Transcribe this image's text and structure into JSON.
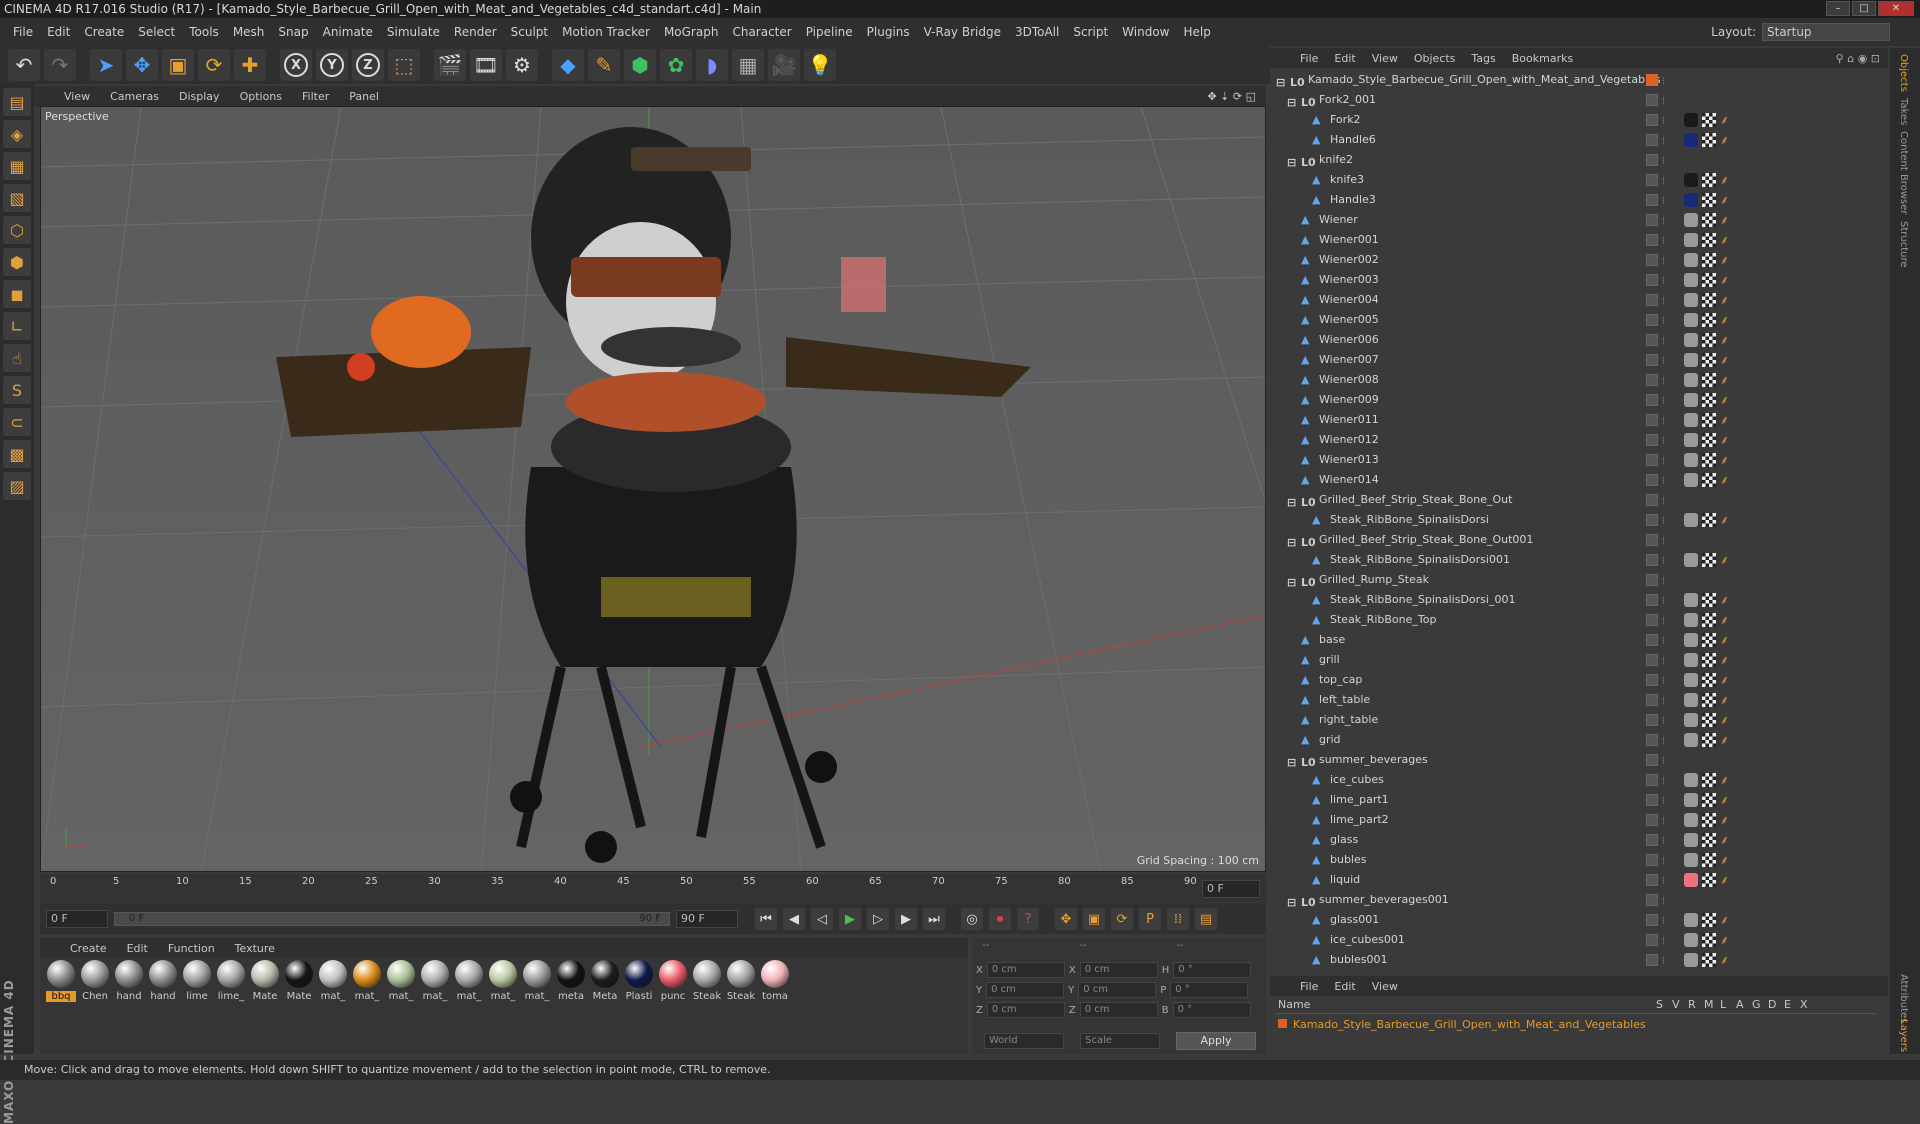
{
  "window": {
    "title": "CINEMA 4D R17.016 Studio (R17) - [Kamado_Style_Barbecue_Grill_Open_with_Meat_and_Vegetables_c4d_standart.c4d] - Main"
  },
  "menubar": {
    "items": [
      "File",
      "Edit",
      "Create",
      "Select",
      "Tools",
      "Mesh",
      "Snap",
      "Animate",
      "Simulate",
      "Render",
      "Sculpt",
      "Motion Tracker",
      "MoGraph",
      "Character",
      "Pipeline",
      "Plugins",
      "V-Ray Bridge",
      "3DToAll",
      "Script",
      "Window",
      "Help"
    ],
    "layout_label": "Layout:",
    "layout_value": "Startup"
  },
  "viewport": {
    "menu": [
      "View",
      "Cameras",
      "Display",
      "Options",
      "Filter",
      "Panel"
    ],
    "label": "Perspective",
    "grid_spacing": "Grid Spacing : 100 cm"
  },
  "timeline": {
    "ticks": [
      "0",
      "5",
      "10",
      "15",
      "20",
      "25",
      "30",
      "35",
      "40",
      "45",
      "50",
      "55",
      "60",
      "65",
      "70",
      "75",
      "80",
      "85",
      "90"
    ],
    "current_frame": "0 F",
    "start_field": "0 F",
    "range_start": "0 F",
    "range_end": "90 F",
    "end_field": "90 F"
  },
  "material_manager": {
    "menu": [
      "Create",
      "Edit",
      "Function",
      "Texture"
    ],
    "materials": [
      {
        "name": "bbq",
        "color": "#8a8a8a"
      },
      {
        "name": "Chen",
        "color": "#9a9a9a"
      },
      {
        "name": "hand",
        "color": "#8e8e8e"
      },
      {
        "name": "hand",
        "color": "#8e8e8e"
      },
      {
        "name": "lime",
        "color": "#a0a0a0"
      },
      {
        "name": "lime_",
        "color": "#a4a4a4"
      },
      {
        "name": "Mate",
        "color": "#b8b8a8"
      },
      {
        "name": "Mate",
        "color": "#151515"
      },
      {
        "name": "mat_",
        "color": "#c0c0c0"
      },
      {
        "name": "mat_",
        "color": "#d98a1a"
      },
      {
        "name": "mat_",
        "color": "#a8c098"
      },
      {
        "name": "mat_",
        "color": "#b0b0b0"
      },
      {
        "name": "mat_",
        "color": "#a8a8a8"
      },
      {
        "name": "mat_",
        "color": "#b8c8a0"
      },
      {
        "name": "mat_",
        "color": "#9a9a9a"
      },
      {
        "name": "meta",
        "color": "#111111"
      },
      {
        "name": "Meta",
        "color": "#1c1c1c"
      },
      {
        "name": "Plasti",
        "color": "#0d1a4a"
      },
      {
        "name": "punc",
        "color": "#e85c6a"
      },
      {
        "name": "Steak",
        "color": "#a8a8a8"
      },
      {
        "name": "Steak",
        "color": "#a4a4a4"
      },
      {
        "name": "toma",
        "color": "#f0b0b8"
      }
    ]
  },
  "coordinates": {
    "header": [
      "--",
      "--",
      "--"
    ],
    "rows": [
      {
        "a": "X",
        "av": "0 cm",
        "b": "X",
        "bv": "0 cm",
        "c": "H",
        "cv": "0 °"
      },
      {
        "a": "Y",
        "av": "0 cm",
        "b": "Y",
        "bv": "0 cm",
        "c": "P",
        "cv": "0 °"
      },
      {
        "a": "Z",
        "av": "0 cm",
        "b": "Z",
        "bv": "0 cm",
        "c": "B",
        "cv": "0 °"
      }
    ],
    "world": "World",
    "scale": "Scale",
    "apply": "Apply"
  },
  "object_manager": {
    "menu": [
      "File",
      "Edit",
      "View",
      "Objects",
      "Tags",
      "Bookmarks"
    ],
    "objects": [
      {
        "name": "Kamado_Style_Barbecue_Grill_Open_with_Meat_and_Vegetables",
        "depth": 0,
        "type": "null",
        "tags": []
      },
      {
        "name": "Fork2_001",
        "depth": 1,
        "type": "null",
        "tags": []
      },
      {
        "name": "Fork2",
        "depth": 2,
        "type": "obj",
        "tags": [
          "dark",
          "tex",
          "phong"
        ]
      },
      {
        "name": "Handle6",
        "depth": 2,
        "type": "obj",
        "tags": [
          "blue",
          "tex",
          "phong"
        ]
      },
      {
        "name": "knife2",
        "depth": 1,
        "type": "null",
        "tags": []
      },
      {
        "name": "knife3",
        "depth": 2,
        "type": "obj",
        "tags": [
          "dark",
          "tex",
          "phong"
        ]
      },
      {
        "name": "Handle3",
        "depth": 2,
        "type": "obj",
        "tags": [
          "blue",
          "tex",
          "phong"
        ]
      },
      {
        "name": "Wiener",
        "depth": 1,
        "type": "obj",
        "tags": [
          "mat",
          "tex",
          "phong"
        ]
      },
      {
        "name": "Wiener001",
        "depth": 1,
        "type": "obj",
        "tags": [
          "mat",
          "tex",
          "phong"
        ]
      },
      {
        "name": "Wiener002",
        "depth": 1,
        "type": "obj",
        "tags": [
          "mat",
          "tex",
          "phong"
        ]
      },
      {
        "name": "Wiener003",
        "depth": 1,
        "type": "obj",
        "tags": [
          "mat",
          "tex",
          "phong"
        ]
      },
      {
        "name": "Wiener004",
        "depth": 1,
        "type": "obj",
        "tags": [
          "mat",
          "tex",
          "phong"
        ]
      },
      {
        "name": "Wiener005",
        "depth": 1,
        "type": "obj",
        "tags": [
          "mat",
          "tex",
          "phong"
        ]
      },
      {
        "name": "Wiener006",
        "depth": 1,
        "type": "obj",
        "tags": [
          "mat",
          "tex",
          "phong"
        ]
      },
      {
        "name": "Wiener007",
        "depth": 1,
        "type": "obj",
        "tags": [
          "mat",
          "tex",
          "phong"
        ]
      },
      {
        "name": "Wiener008",
        "depth": 1,
        "type": "obj",
        "tags": [
          "mat",
          "tex",
          "phong"
        ]
      },
      {
        "name": "Wiener009",
        "depth": 1,
        "type": "obj",
        "tags": [
          "mat",
          "tex",
          "phong"
        ]
      },
      {
        "name": "Wiener011",
        "depth": 1,
        "type": "obj",
        "tags": [
          "mat",
          "tex",
          "phong"
        ]
      },
      {
        "name": "Wiener012",
        "depth": 1,
        "type": "obj",
        "tags": [
          "mat",
          "tex",
          "phong"
        ]
      },
      {
        "name": "Wiener013",
        "depth": 1,
        "type": "obj",
        "tags": [
          "mat",
          "tex",
          "phong"
        ]
      },
      {
        "name": "Wiener014",
        "depth": 1,
        "type": "obj",
        "tags": [
          "mat",
          "tex",
          "phong"
        ]
      },
      {
        "name": "Grilled_Beef_Strip_Steak_Bone_Out",
        "depth": 1,
        "type": "null",
        "tags": []
      },
      {
        "name": "Steak_RibBone_SpinalisDorsi",
        "depth": 2,
        "type": "obj",
        "tags": [
          "mat",
          "tex",
          "phong"
        ]
      },
      {
        "name": "Grilled_Beef_Strip_Steak_Bone_Out001",
        "depth": 1,
        "type": "null",
        "tags": []
      },
      {
        "name": "Steak_RibBone_SpinalisDorsi001",
        "depth": 2,
        "type": "obj",
        "tags": [
          "mat",
          "tex",
          "phong"
        ]
      },
      {
        "name": "Grilled_Rump_Steak",
        "depth": 1,
        "type": "null",
        "tags": []
      },
      {
        "name": "Steak_RibBone_SpinalisDorsi_001",
        "depth": 2,
        "type": "obj",
        "tags": [
          "mat",
          "tex",
          "phong"
        ]
      },
      {
        "name": "Steak_RibBone_Top",
        "depth": 2,
        "type": "obj",
        "tags": [
          "mat",
          "tex",
          "phong"
        ]
      },
      {
        "name": "base",
        "depth": 1,
        "type": "obj",
        "tags": [
          "mat",
          "tex",
          "phong"
        ]
      },
      {
        "name": "grill",
        "depth": 1,
        "type": "obj",
        "tags": [
          "mat",
          "tex",
          "phong"
        ]
      },
      {
        "name": "top_cap",
        "depth": 1,
        "type": "obj",
        "tags": [
          "mat",
          "tex",
          "phong"
        ]
      },
      {
        "name": "left_table",
        "depth": 1,
        "type": "obj",
        "tags": [
          "mat",
          "tex",
          "phong"
        ]
      },
      {
        "name": "right_table",
        "depth": 1,
        "type": "obj",
        "tags": [
          "mat",
          "tex",
          "phong"
        ]
      },
      {
        "name": "grid",
        "depth": 1,
        "type": "obj",
        "tags": [
          "mat",
          "tex",
          "phong"
        ]
      },
      {
        "name": "summer_beverages",
        "depth": 1,
        "type": "null",
        "tags": []
      },
      {
        "name": "ice_cubes",
        "depth": 2,
        "type": "obj",
        "tags": [
          "mat",
          "tex",
          "phong"
        ]
      },
      {
        "name": "lime_part1",
        "depth": 2,
        "type": "obj",
        "tags": [
          "mat",
          "tex",
          "phong"
        ]
      },
      {
        "name": "lime_part2",
        "depth": 2,
        "type": "obj",
        "tags": [
          "mat",
          "tex",
          "phong"
        ]
      },
      {
        "name": "glass",
        "depth": 2,
        "type": "obj",
        "tags": [
          "mat",
          "tex",
          "phong"
        ]
      },
      {
        "name": "bubles",
        "depth": 2,
        "type": "obj",
        "tags": [
          "mat",
          "tex",
          "phong"
        ]
      },
      {
        "name": "liquid",
        "depth": 2,
        "type": "obj",
        "tags": [
          "pink",
          "tex",
          "phong"
        ]
      },
      {
        "name": "summer_beverages001",
        "depth": 1,
        "type": "null",
        "tags": []
      },
      {
        "name": "glass001",
        "depth": 2,
        "type": "obj",
        "tags": [
          "mat",
          "tex",
          "phong"
        ]
      },
      {
        "name": "ice_cubes001",
        "depth": 2,
        "type": "obj",
        "tags": [
          "mat",
          "tex",
          "phong"
        ]
      },
      {
        "name": "bubles001",
        "depth": 2,
        "type": "obj",
        "tags": [
          "mat",
          "tex",
          "phong"
        ]
      }
    ]
  },
  "attribute_manager": {
    "menu": [
      "File",
      "Edit",
      "View"
    ],
    "columns": [
      "Name",
      "S",
      "V",
      "R",
      "M",
      "L",
      "A",
      "G",
      "D",
      "E",
      "X"
    ],
    "selected_object": "Kamado_Style_Barbecue_Grill_Open_with_Meat_and_Vegetables"
  },
  "right_tabs": [
    "Objects",
    "Takes",
    "Content Browser",
    "Structure"
  ],
  "right_tabs_lower": [
    "Attributes",
    "Layers"
  ],
  "maxon_logo": "MAXON CINEMA 4D",
  "status": "Move: Click and drag to move elements. Hold down SHIFT to quantize movement / add to the selection in point mode, CTRL to remove.",
  "colors": {
    "accent": "#e69a2a",
    "selected_object": "#e69a2a",
    "sel_blue": "#5fa8e8"
  }
}
